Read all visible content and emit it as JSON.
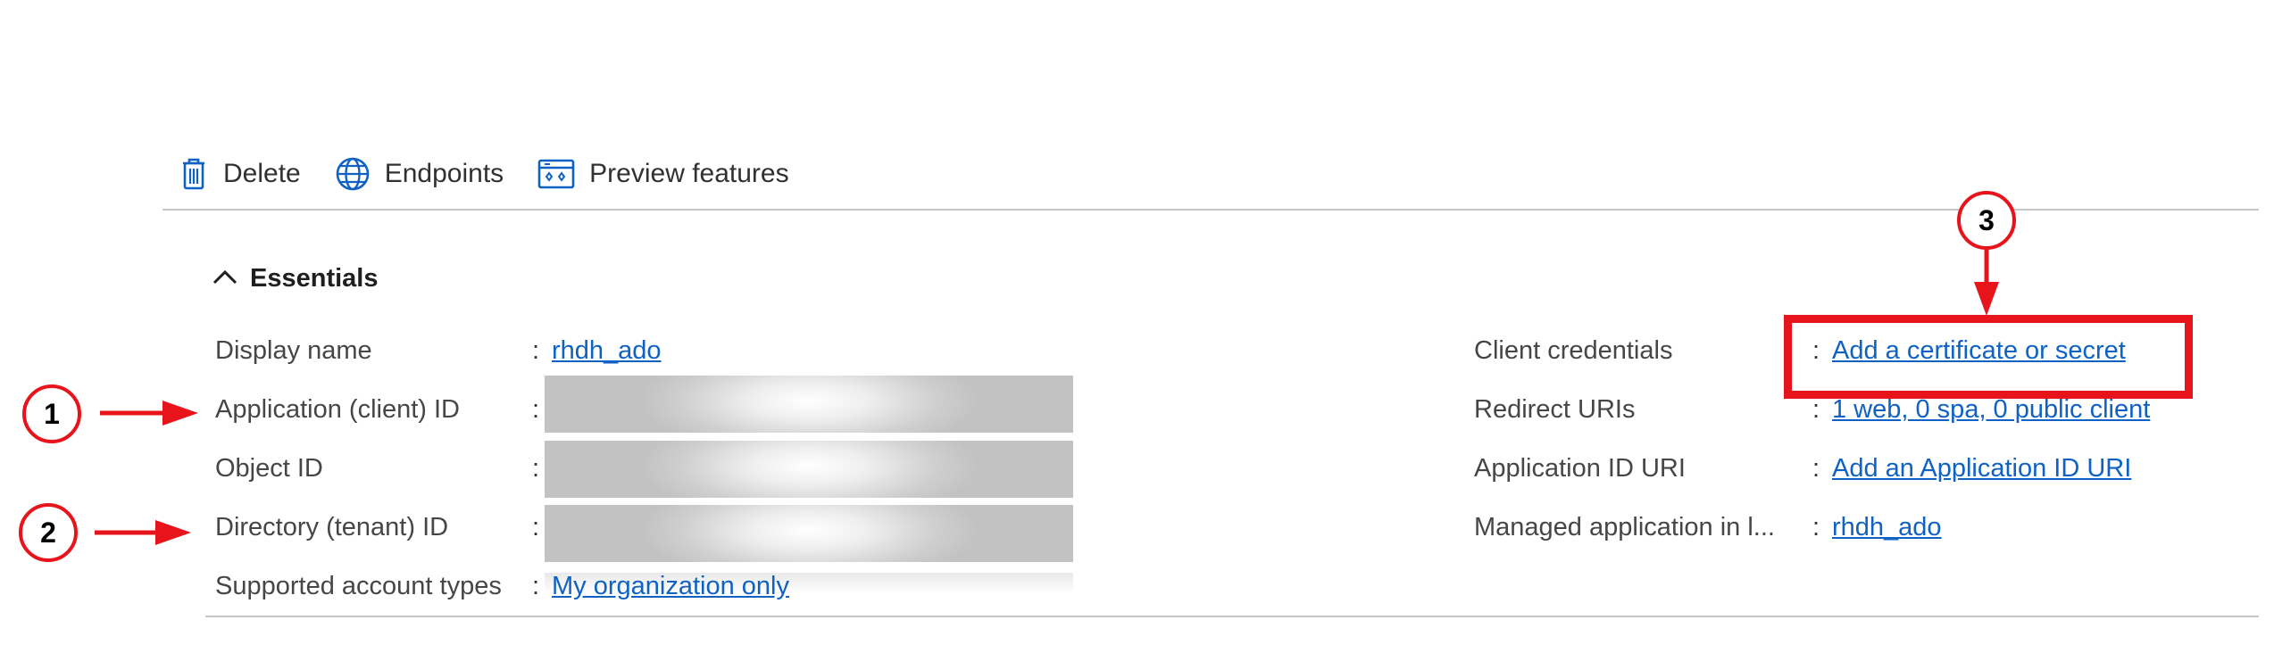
{
  "toolbar": {
    "items": [
      {
        "label": "Delete",
        "icon": "trash-icon"
      },
      {
        "label": "Endpoints",
        "icon": "globe-icon"
      },
      {
        "label": "Preview features",
        "icon": "preview-features-icon"
      }
    ]
  },
  "essentials": {
    "title": "Essentials",
    "left": [
      {
        "label": "Display name",
        "value": "rhdh_ado",
        "kind": "link"
      },
      {
        "label": "Application (client) ID",
        "value": null,
        "kind": "redacted"
      },
      {
        "label": "Object ID",
        "value": null,
        "kind": "redacted"
      },
      {
        "label": "Directory (tenant) ID",
        "value": null,
        "kind": "redacted"
      },
      {
        "label": "Supported account types",
        "value": "My organization only",
        "kind": "link"
      }
    ],
    "right": [
      {
        "label": "Client credentials",
        "value": "Add a certificate or secret",
        "kind": "link"
      },
      {
        "label": "Redirect URIs",
        "value": "1 web, 0 spa, 0 public client",
        "kind": "link"
      },
      {
        "label": "Application ID URI",
        "value": "Add an Application ID URI",
        "kind": "link"
      },
      {
        "label": "Managed application in l...",
        "value": "rhdh_ado",
        "kind": "link"
      }
    ],
    "separator": ":"
  },
  "annotations": {
    "badges": [
      "1",
      "2",
      "3"
    ],
    "accent_color": "#e8141c"
  },
  "colors": {
    "link": "#0f62c4",
    "icon": "#0f62c4",
    "text": "#323130"
  }
}
